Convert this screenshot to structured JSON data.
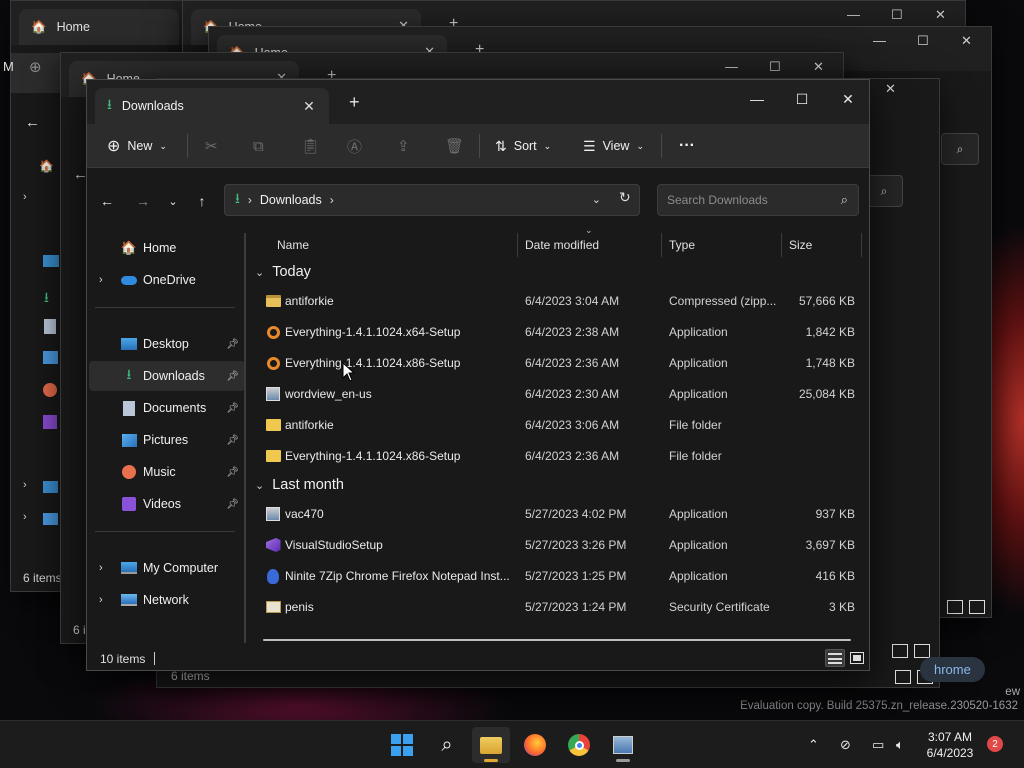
{
  "background": {
    "tab_label": "Home",
    "tab_label_cut": "Ho",
    "status_text": "6 items",
    "status_text_cut": "6 i",
    "letter_m": "M",
    "pill_text": "hrome",
    "eval_watermark": "Evaluation copy. Build 25375.zn_release.230520-1632",
    "watermark_cut": "ew"
  },
  "window": {
    "tab_label": "Downloads",
    "new_tab": "+",
    "controls": {
      "minimize": "—",
      "maximize": "☐",
      "close": "✕"
    }
  },
  "toolbar": {
    "new_label": "New",
    "sort_label": "Sort",
    "view_label": "View",
    "more_label": "···"
  },
  "address": {
    "location": "Downloads",
    "search_placeholder": "Search Downloads"
  },
  "nav": {
    "items": [
      {
        "label": "Home",
        "icon": "home-icon"
      },
      {
        "label": "OneDrive",
        "icon": "cloud-icon"
      },
      {
        "label": "Desktop",
        "icon": "desktop-icon",
        "pinned": true
      },
      {
        "label": "Downloads",
        "icon": "download-icon",
        "pinned": true,
        "selected": true
      },
      {
        "label": "Documents",
        "icon": "document-icon",
        "pinned": true
      },
      {
        "label": "Pictures",
        "icon": "picture-icon",
        "pinned": true
      },
      {
        "label": "Music",
        "icon": "music-icon",
        "pinned": true
      },
      {
        "label": "Videos",
        "icon": "video-icon",
        "pinned": true
      },
      {
        "label": "My Computer",
        "icon": "computer-icon"
      },
      {
        "label": "Network",
        "icon": "network-icon"
      }
    ]
  },
  "columns": {
    "name": "Name",
    "date": "Date modified",
    "type": "Type",
    "size": "Size"
  },
  "groups": [
    {
      "label": "Today",
      "files": [
        {
          "name": "antiforkie",
          "date": "6/4/2023 3:04 AM",
          "type": "Compressed (zipp...",
          "size": "57,666 KB",
          "icon": "zip-folder-icon"
        },
        {
          "name": "Everything-1.4.1.1024.x64-Setup",
          "date": "6/4/2023 2:38 AM",
          "type": "Application",
          "size": "1,842 KB",
          "icon": "everything-app-icon"
        },
        {
          "name": "Everything-1.4.1.1024.x86-Setup",
          "date": "6/4/2023 2:36 AM",
          "type": "Application",
          "size": "1,748 KB",
          "icon": "everything-app-icon"
        },
        {
          "name": "wordview_en-us",
          "date": "6/4/2023 2:30 AM",
          "type": "Application",
          "size": "25,084 KB",
          "icon": "installer-icon"
        },
        {
          "name": "antiforkie",
          "date": "6/4/2023 3:06 AM",
          "type": "File folder",
          "size": "",
          "icon": "folder-icon"
        },
        {
          "name": "Everything-1.4.1.1024.x86-Setup",
          "date": "6/4/2023 2:36 AM",
          "type": "File folder",
          "size": "",
          "icon": "folder-icon"
        }
      ]
    },
    {
      "label": "Last month",
      "files": [
        {
          "name": "vac470",
          "date": "5/27/2023 4:02 PM",
          "type": "Application",
          "size": "937 KB",
          "icon": "installer-icon"
        },
        {
          "name": "VisualStudioSetup",
          "date": "5/27/2023 3:26 PM",
          "type": "Application",
          "size": "3,697 KB",
          "icon": "visual-studio-icon"
        },
        {
          "name": "Ninite 7Zip Chrome Firefox Notepad Inst...",
          "date": "5/27/2023 1:25 PM",
          "type": "Application",
          "size": "416 KB",
          "icon": "ninite-icon"
        },
        {
          "name": "penis",
          "date": "5/27/2023 1:24 PM",
          "type": "Security Certificate",
          "size": "3 KB",
          "icon": "certificate-icon"
        }
      ]
    }
  ],
  "status": {
    "item_count": "10 items"
  },
  "taskbar": {
    "time": "3:07 AM",
    "date": "6/4/2023",
    "notifications": "2"
  }
}
